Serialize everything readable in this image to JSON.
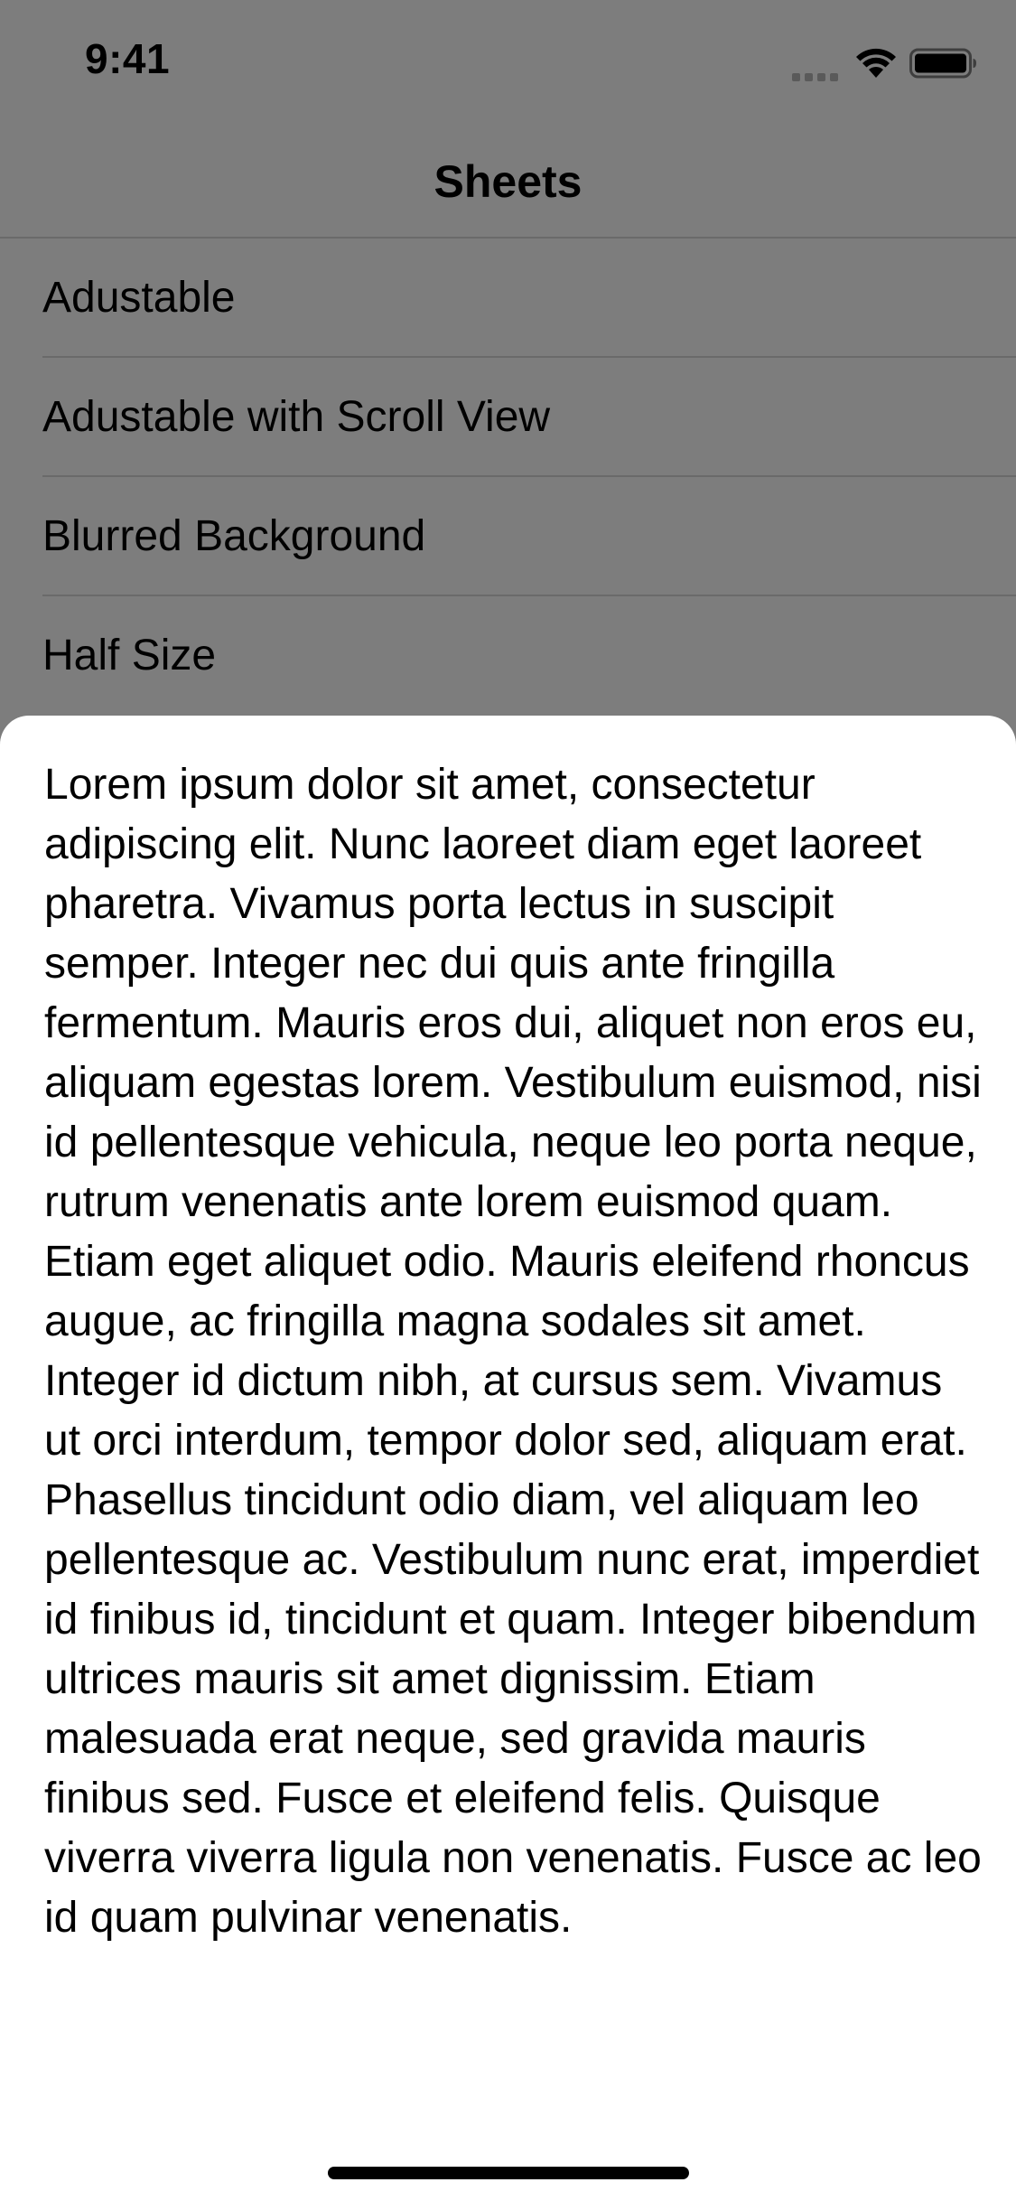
{
  "status_bar": {
    "time": "9:41",
    "icons": [
      "cellular-signal-icon",
      "wifi-icon",
      "battery-icon"
    ]
  },
  "nav": {
    "title": "Sheets"
  },
  "list": {
    "items": [
      {
        "label": "Adustable"
      },
      {
        "label": "Adustable with Scroll View"
      },
      {
        "label": "Blurred Background"
      },
      {
        "label": "Half Size"
      }
    ]
  },
  "sheet": {
    "body": "Lorem ipsum dolor sit amet, consectetur adipiscing elit. Nunc laoreet diam eget laoreet pharetra. Vivamus porta lectus in suscipit semper. Integer nec dui quis ante fringilla fermentum. Mauris eros dui, aliquet non eros eu, aliquam egestas lorem. Vestibulum euismod, nisi id pellentesque vehicula, neque leo porta neque, rutrum venenatis ante lorem euismod quam. Etiam eget aliquet odio. Mauris eleifend rhoncus augue, ac fringilla magna sodales sit amet. Integer id dictum nibh, at cursus sem. Vivamus ut orci interdum, tempor dolor sed, aliquam erat. Phasellus tincidunt odio diam, vel aliquam leo pellentesque ac. Vestibulum nunc erat, imperdiet id finibus id, tincidunt et quam. Integer bibendum ultrices mauris sit amet dignissim. Etiam malesuada erat neque, sed gravida mauris finibus sed. Fusce et eleifend felis. Quisque viverra viverra ligula non venenatis. Fusce ac leo id quam pulvinar venenatis."
  },
  "colors": {
    "dimmed_background": "#7d7d7d",
    "sheet_background": "#ffffff",
    "divider": "#6a6a6a",
    "text": "#000000"
  }
}
